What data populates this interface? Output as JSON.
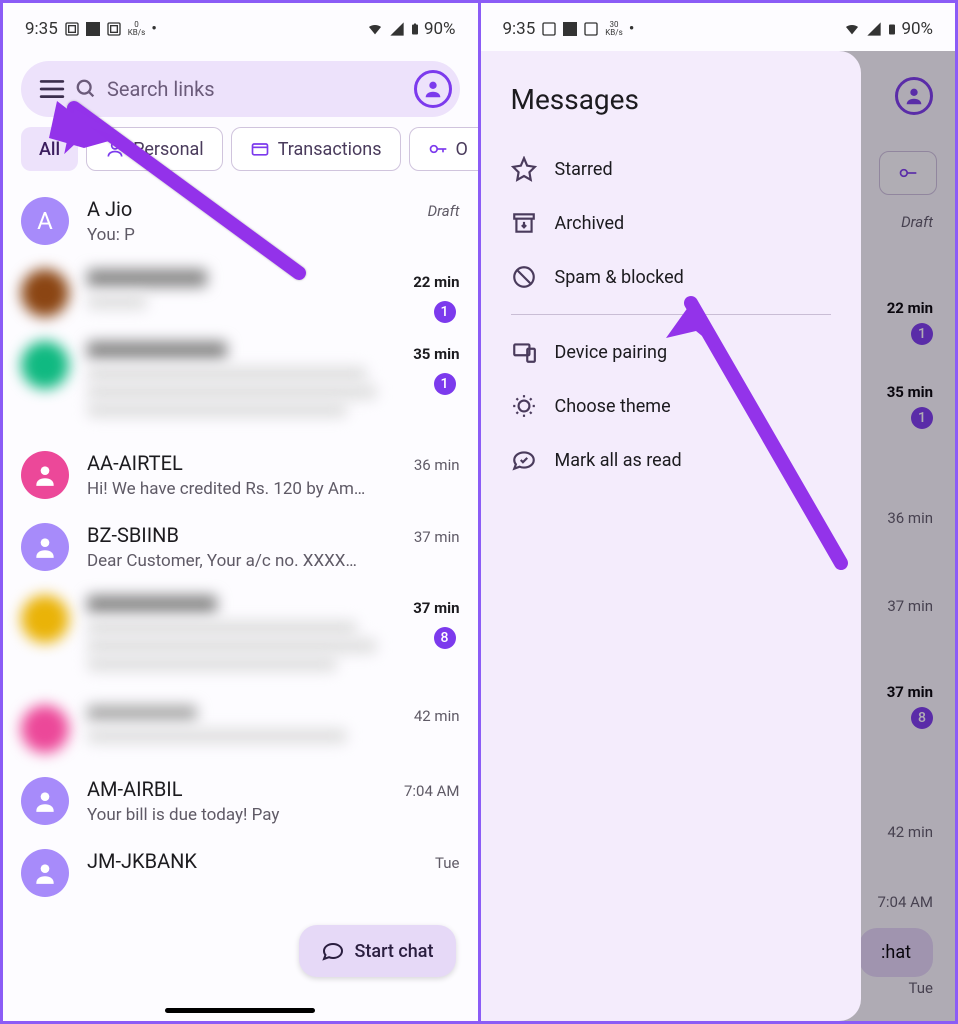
{
  "status": {
    "time": "9:35",
    "kb1": "0",
    "kb2": "30",
    "kbu": "KB/s",
    "battery": "90%"
  },
  "search": {
    "placeholder": "Search links"
  },
  "filters": {
    "all": "All",
    "personal": "Personal",
    "trans": "Transactions",
    "o": "O"
  },
  "draft": "Draft",
  "conv": [
    {
      "name": "A Jio",
      "prev": "You: P",
      "time": "Draft",
      "avatar": "A",
      "color": "#a78bfa"
    },
    {
      "name": "",
      "prev": "",
      "time": "22 min",
      "badge": "1",
      "color": "#8b4513",
      "bold": true,
      "blur": true
    },
    {
      "name": "",
      "prev": "",
      "time": "35 min",
      "badge": "1",
      "color": "#10b981",
      "bold": true,
      "blur": true,
      "tall": true
    },
    {
      "name": "AA-AIRTEL",
      "prev": "Hi! We have credited Rs. 120 by Ama...",
      "time": "36 min",
      "color": "#ec4899"
    },
    {
      "name": "BZ-SBIINB",
      "prev": "Dear Customer, Your a/c no. XXXXXX...",
      "time": "37 min",
      "color": "#a78bfa"
    },
    {
      "name": "",
      "prev": "",
      "time": "37 min",
      "badge": "8",
      "color": "#eab308",
      "bold": true,
      "blur": true,
      "tall": true
    },
    {
      "name": "",
      "prev": "",
      "time": "42 min",
      "color": "#ec4899",
      "blur": true
    },
    {
      "name": "AM-AIRBIL",
      "prev": "Your bill is due today! Pay",
      "time": "7:04 AM",
      "color": "#a78bfa"
    },
    {
      "name": "JM-JKBANK",
      "prev": "",
      "time": "Tue",
      "color": "#a78bfa"
    }
  ],
  "fab": "Start chat",
  "drawer": {
    "title": "Messages",
    "starred": "Starred",
    "archived": "Archived",
    "spam": "Spam & blocked",
    "pairing": "Device pairing",
    "theme": "Choose theme",
    "markread": "Mark all as read"
  }
}
